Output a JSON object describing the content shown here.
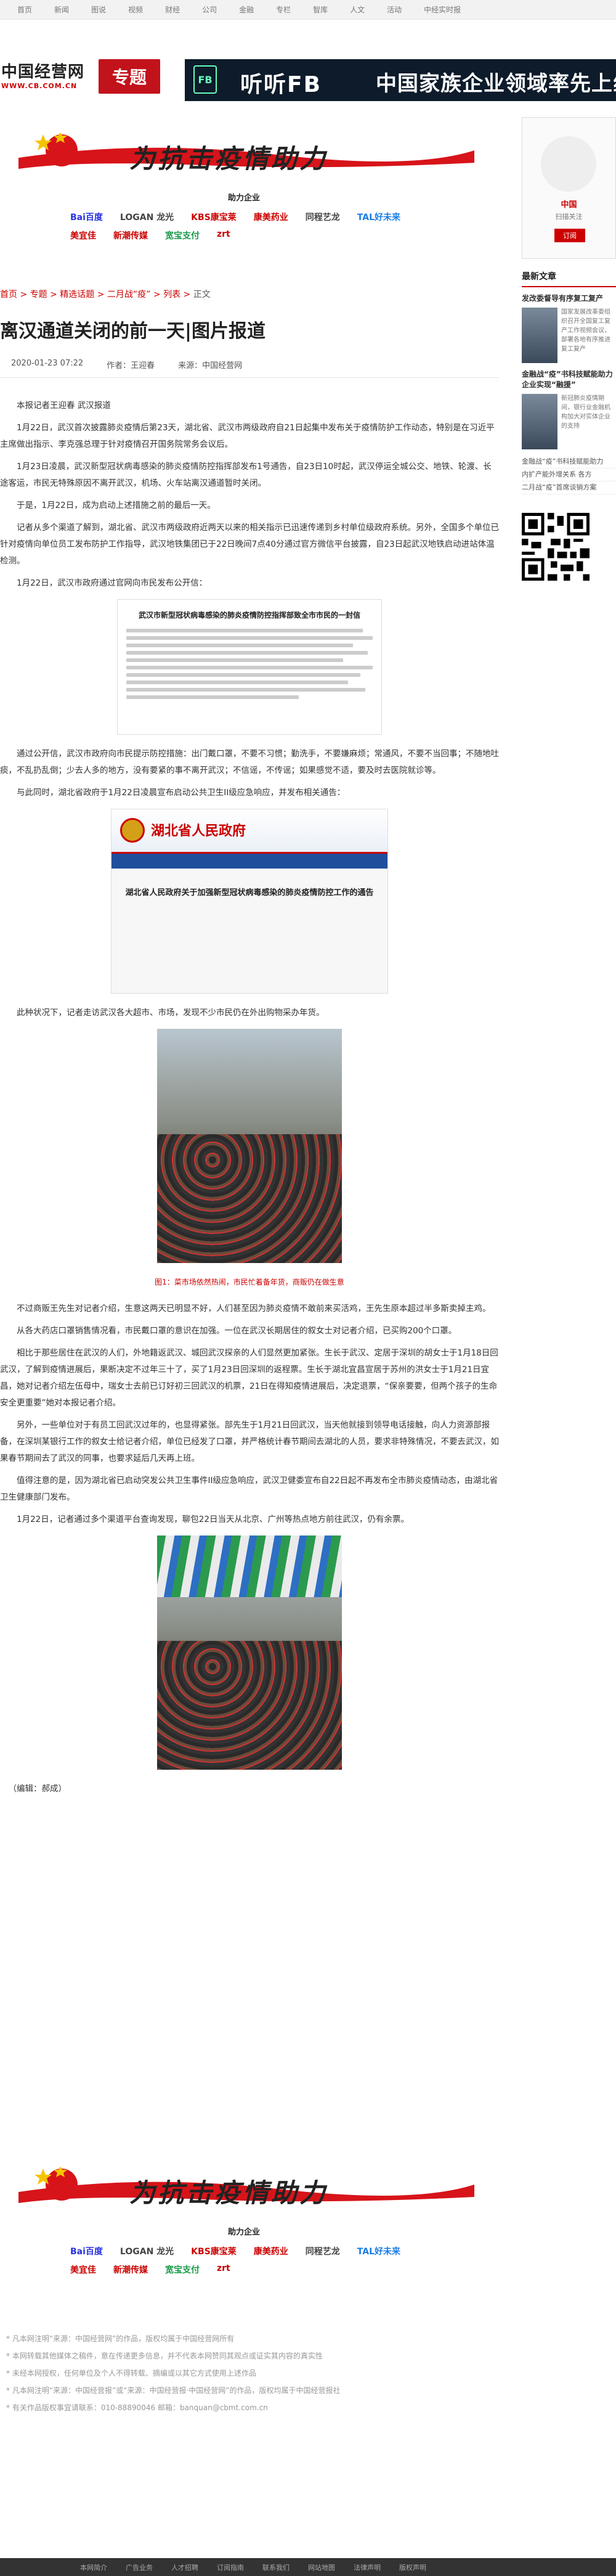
{
  "topnav": [
    "首页",
    "新闻",
    "图说",
    "视频",
    "财经",
    "公司",
    "金融",
    "专栏",
    "智库",
    "人文",
    "活动",
    "中经实时报"
  ],
  "logo": {
    "name": "中国经营网",
    "url": "WWW.CB.COM.CN"
  },
  "zhuanti": "专题",
  "banner": {
    "brand": "FB",
    "title": "听听FB",
    "subtitle": "中国家族企业领域率先上线"
  },
  "promo": {
    "slogan": "为抗击疫情助力",
    "sub": "助力企业",
    "sponsors": [
      "Bai百度",
      "LOGAN 龙光",
      "KBS康宝莱",
      "康美药业",
      "同程艺龙",
      "TAL好未来",
      "美宜佳",
      "新潮传媒",
      "宽宝支付",
      "zrt"
    ]
  },
  "breadcrumb": {
    "items": [
      "首页",
      "专题",
      "精选话题",
      "二月战“疫”",
      "列表"
    ],
    "current": "正文",
    "sep": " > "
  },
  "article": {
    "title": "离汉通道关闭的前一天|图片报道",
    "date": "2020-01-23 07:22",
    "author": "作者：王迎春",
    "source": "来源：中国经营网",
    "p1": "本报记者王迎春 武汉报道",
    "p2": "1月22日，武汉首次披露肺炎疫情后第23天，湖北省、武汉市两级政府自21日起集中发布关于疫情防护工作动态，特别是在习近平主席做出指示、李克强总理于针对疫情召开国务院常务会议后。",
    "p3": "1月23日凌晨，武汉新型冠状病毒感染的肺炎疫情防控指挥部发布1号通告，自23日10时起，武汉停运全城公交、地铁、轮渡、长途客运，市民无特殊原因不离开武汉，机场、火车站离汉通道暂时关闭。",
    "p4": "于是，1月22日，成为启动上述措施之前的最后一天。",
    "p5": "记者从多个渠道了解到，湖北省、武汉市两级政府近两天以来的相关指示已迅速传递到乡村单位级政府系统。另外，全国多个单位已针对疫情向单位员工发布防护工作指导，武汉地铁集团已于22日晚间7点40分通过官方微信平台披露，自23日起武汉地铁启动进站体温检测。",
    "p6": "1月22日，武汉市政府通过官网向市民发布公开信：",
    "doc_title": "武汉市新型冠状病毒感染的肺炎疫情防控指挥部致全市市民的一封信",
    "p7": "通过公开信，武汉市政府向市民提示防控措施：出门戴口罩，不要不习惯；勤洗手，不要嫌麻烦；常通风，不要不当回事；不随地吐痰，不乱扔乱倒；少去人多的地方，没有要紧的事不离开武汉；不信谣，不传谣；如果感觉不适，要及时去医院就诊等。",
    "p8": "与此同时，湖北省政府于1月22日凌晨宣布启动公共卫生II级应急响应，并发布相关通告：",
    "gov_name": "湖北省人民政府",
    "gov_title": "湖北省人民政府关于加强新型冠状病毒感染的肺炎疫情防控工作的通告",
    "p9": "此种状况下，记者走访武汉各大超市、市场，发现不少市民仍在外出购物采办年货。",
    "caption1": "图1：菜市场依然热闹，市民忙着备年货，商贩仍在做生意",
    "p10": "不过商贩王先生对记者介绍，生意这两天已明显不好，人们甚至因为肺炎疫情不敢前来买活鸡，王先生原本超过半多斯卖掉主鸡。",
    "p11": "从各大药店口罩销售情况看，市民戴口罩的意识在加强。一位在武汉长期居住的叙女士对记者介绍，已买购200个口罩。",
    "p12": "相比于那些居住在武汉的人们，外地籍返武汉、城回武汉探亲的人们显然更加紧张。生长于武汉、定居于深圳的胡女士于1月18日回武汉，了解到疫情进展后，果断决定不过年三十了，买了1月23日回深圳的返程票。生长于湖北宜昌宣居于苏州的洪女士于1月21日宜昌，她对记者介绍左伍母中，瑞女士去前已订好初三回武汉的机票，21日在得知疫情进展后，决定退票，“保亲要要，但两个孩子的生命安全更重要”她对本报记者介绍。",
    "p13": "另外，一些单位对于有员工回武汉过年的，也显得紧张。部先生于1月21日回武汉，当天他就接到领导电话接触，向人力资源部报备，在深圳某银行工作的叙女士给记者介绍，单位已经发了口罩，并严格统计春节期间去湖北的人员，要求非特殊情况，不要去武汉，如果春节期间去了武汉的同事，也要求延后几天再上班。",
    "p14": "值得注意的是，因为湖北省已启动突发公共卫生事件II级应急响应，武汉卫健委宣布自22日起不再发布全市肺炎疫情动态，由湖北省卫生健康部门发布。",
    "p15": "1月22日，记者通过多个渠道平台查询发现，聊包22日当天从北京、广州等热点地方前往武汉，仍有余票。",
    "editor": "（编辑：郝成）"
  },
  "sidebar": {
    "ad_title": "中国",
    "ad_sub": "扫描关注",
    "ad_btn": "订阅",
    "section": "最新文章",
    "item1_title": "发改委督导有序复工复产",
    "item1_text": "国家发展改革委组织召开全国复工复产工作视频会议，部署各地有序推进复工复产",
    "item2_title": "金融战“疫”书科技赋能助力企业实现“融援”",
    "item2_text": "新冠肺炎疫情期间，银行业金融机构加大对实体企业的支持",
    "links": [
      "金融战“疫”书科技赋能助力",
      "内扩产能外增关系 各方",
      "二月战“疫”首席谈销方案"
    ]
  },
  "disclaimer": [
    "* 凡本网注明“来源：中国经营网”的作品，版权均属于中国经营网所有",
    "* 本网转载其他媒体之稿件，意在传递更多信息，并不代表本网赞同其观点或证实其内容的真实性",
    "* 未经本网授权，任何单位及个人不得转载、摘编或以其它方式使用上述作品",
    "* 凡本网注明“来源：中国经营报”或“来源：中国经营报·中国经营网”的作品，版权均属于中国经营报社",
    "* 有关作品版权事宜请联系：010-88890046 邮箱：banquan@cbmt.com.cn"
  ],
  "footer": [
    "本网简介",
    "广告业务",
    "人才招聘",
    "订阅指南",
    "联系我们",
    "网站地图",
    "法律声明",
    "版权声明"
  ]
}
